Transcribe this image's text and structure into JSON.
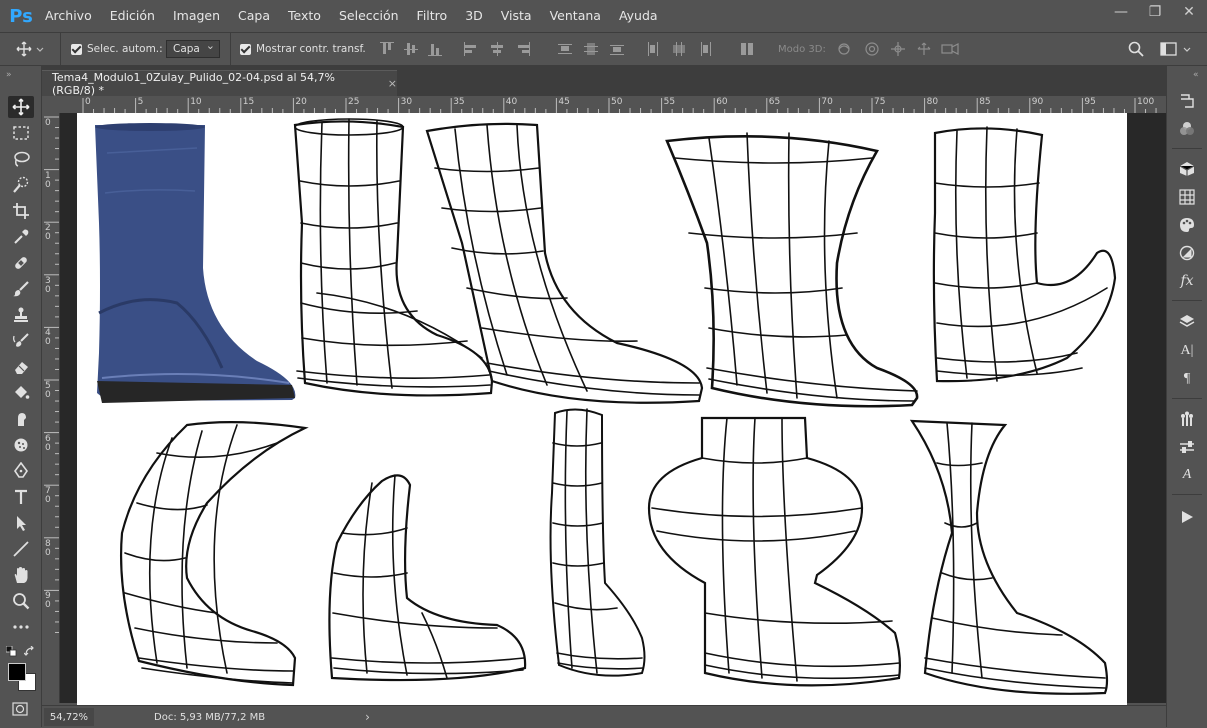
{
  "app": {
    "logo": "Ps"
  },
  "menu": [
    "Archivo",
    "Edición",
    "Imagen",
    "Capa",
    "Texto",
    "Selección",
    "Filtro",
    "3D",
    "Vista",
    "Ventana",
    "Ayuda"
  ],
  "window_controls": {
    "minimize": "—",
    "restore": "❐",
    "close": "✕"
  },
  "options": {
    "auto_select_label": "Selec. autom.:",
    "auto_select_target": "Capa",
    "show_transform_label": "Mostrar contr. transf.",
    "mode3d_label": "Modo 3D:"
  },
  "document_tab": {
    "title": "Tema4_Modulo1_0Zulay_Pulido_02-04.psd al 54,7% (RGB/8) *",
    "close": "×"
  },
  "ruler_top_labels": [
    "0",
    "5",
    "10",
    "15",
    "20",
    "25",
    "30",
    "35",
    "40",
    "45",
    "50",
    "55",
    "60",
    "65",
    "70",
    "75",
    "80",
    "85",
    "90",
    "95",
    "100"
  ],
  "ruler_left_labels": [
    "0",
    "1\n0",
    "2\n0",
    "3\n0",
    "4\n0",
    "5\n0",
    "6\n0",
    "7\n0",
    "8\n0",
    "9\n0"
  ],
  "status": {
    "zoom": "54,72%",
    "doc_info": "Doc: 5,93 MB/77,2 MB",
    "arrow": "›"
  },
  "colors": {
    "accent": "#31a8ff",
    "panel_bg": "#535353",
    "canvas_bg": "#282828",
    "boot_blue": "#3a4f86"
  }
}
